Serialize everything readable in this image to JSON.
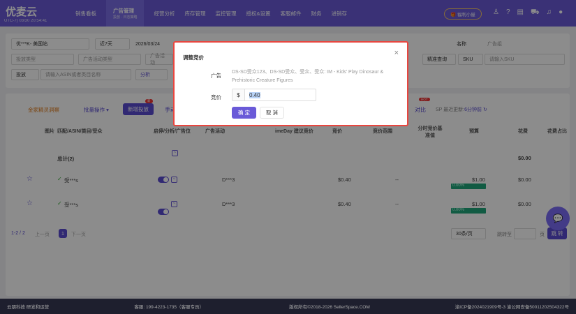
{
  "header": {
    "logo": "优麦云",
    "timezone": "UTC-7) 03/30 20:54:41",
    "nav": [
      {
        "label": "销售看板"
      },
      {
        "label": "广告管理",
        "sub": "投放 · 日志策略",
        "active": true
      },
      {
        "label": "经营分析"
      },
      {
        "label": "库存管理"
      },
      {
        "label": "监控管理"
      },
      {
        "label": "授权&设置"
      },
      {
        "label": "客服邮件"
      },
      {
        "label": "财务"
      },
      {
        "label": "进销存"
      }
    ],
    "gift_label": "福利小屋"
  },
  "filters": {
    "shop": "优***K- 美国站",
    "range": "近7天",
    "date": "2026/03/24",
    "type_ph": "投放类型",
    "campaign_type_ph": "广告活动类型",
    "campaign_ph": "广告活动",
    "target_mode": "投放",
    "asin_ph": "请输入ASIN或者类目名称",
    "analyze": "分析",
    "name_sel": "名称",
    "name_ph": "广告组",
    "exact": "精准查询",
    "sku_sel": "SKU",
    "sku_ph": "请输入SKU"
  },
  "toolbar": {
    "insight": "金家精灵洞察",
    "batch": "批量操作",
    "add": "新增投放",
    "add_badge": "新",
    "manual": "手动",
    "hot": "HOT",
    "compare": "对比",
    "update": "SP 最近更新:",
    "update_time": "6分钟前"
  },
  "table": {
    "headers": [
      "图片",
      "匹配/ASIN/类目/受众",
      "启停/分析/广告位",
      "广告活动",
      "imeDay 建议竞价",
      "竞价",
      "竞价范围",
      "分时竞价基准值",
      "预算",
      "花费",
      "花费占比"
    ],
    "total": {
      "label": "总计(2)",
      "spend": "$0.00"
    },
    "rows": [
      {
        "name": "受***s",
        "campaign": "D***3",
        "bid": "$0.40",
        "range": "--",
        "budget": "$1.00",
        "pct": "0.00%",
        "spend": "$0.00"
      },
      {
        "name": "受***s",
        "campaign": "D***3",
        "bid": "$0.40",
        "range": "--",
        "budget": "$1.00",
        "pct": "0.00%",
        "spend": "$0.00"
      }
    ]
  },
  "pagination": {
    "summary": "1-2 / 2",
    "prev": "上一页",
    "page": "1",
    "next": "下一页",
    "per_page": "30条/页",
    "goto": "跳转至",
    "page_unit": "页",
    "jump": "跳 转"
  },
  "footer": {
    "left": "云朋科技 研发和运营",
    "phone": "客服: 199-4223-1735（客服专员）",
    "copyright": "版权所有©2018-2026 SellerSpace.COM",
    "icp": "渝ICP备2024021909号-3  渝公网安备50011202504322号"
  },
  "modal": {
    "title": "调整竞价",
    "ad_label": "广告",
    "ad_value": "DS-SD受众123、DS-SD受众、受众、受众: IM - Kids' Play Dinosaur & Prehistoric Creature Figures",
    "bid_label": "竞价",
    "currency": "$",
    "bid_value": "0.40",
    "confirm": "确 定",
    "cancel": "取 消"
  },
  "colors": {
    "primary": "#6a5ad8",
    "modal_border": "#e8463f",
    "budget_bar": "#1fa67a"
  }
}
